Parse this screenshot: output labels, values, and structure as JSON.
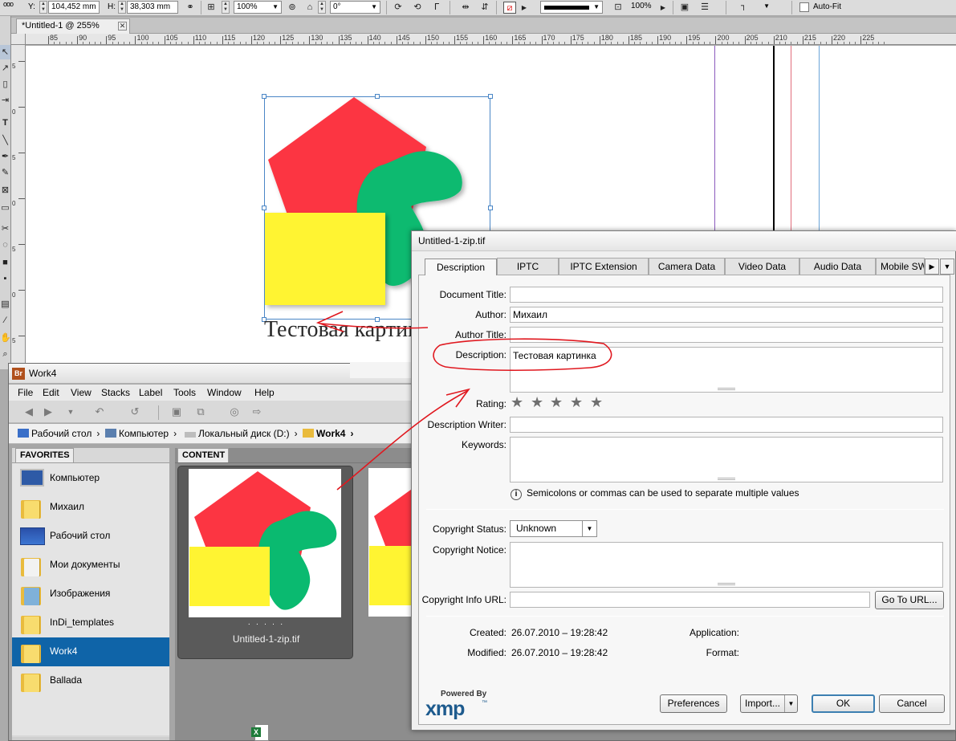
{
  "indesign": {
    "control_bar": {
      "y_label": "Y:",
      "y_value": "104,452 mm",
      "h_label": "H:",
      "h_value": "38,303 mm",
      "scale_value": "100%",
      "angle_value": "0°",
      "stroke_value": "100%",
      "autofit_label": "Auto-Fit"
    },
    "doc_tab_title": "*Untitled-1 @ 255%",
    "ruler_numbers": [
      "85",
      "90",
      "95",
      "100",
      "105",
      "110",
      "115",
      "120",
      "125",
      "130",
      "135",
      "140",
      "145",
      "150",
      "155",
      "160",
      "165",
      "170",
      "175",
      "180",
      "185",
      "190",
      "195",
      "200",
      "205",
      "210",
      "215",
      "220",
      "225"
    ],
    "vruler_numbers": [
      "5",
      "0",
      "5",
      "0",
      "5",
      "0",
      "5"
    ],
    "canvas_caption": "Тестовая картинка",
    "colors": {
      "pentagon": "#fc3542",
      "green_shape": "#0aba70",
      "yellow_rect": "#fff432",
      "selection": "#4a86c6",
      "annotation": "#e0181f"
    }
  },
  "bridge": {
    "title": "Work4",
    "app_icon": "Br",
    "menu": [
      "File",
      "Edit",
      "View",
      "Stacks",
      "Label",
      "Tools",
      "Window",
      "Help"
    ],
    "path": [
      "Рабочий стол",
      "Компьютер",
      "Локальный диск (D:)",
      "Work4"
    ],
    "favorites_tab": "FAVORITES",
    "favorites": [
      "Компьютер",
      "Михаил",
      "Рабочий стол",
      "Мои документы",
      "Изображения",
      "InDi_templates",
      "Work4",
      "Ballada"
    ],
    "selected_favorite": "Work4",
    "content_tab": "CONTENT",
    "thumbnail_name": "Untitled-1-zip.tif",
    "thumbnail_rating_dots": "· · · · ·"
  },
  "dialog": {
    "title": "Untitled-1-zip.tif",
    "tabs": [
      "Description",
      "IPTC",
      "IPTC Extension",
      "Camera Data",
      "Video Data",
      "Audio Data",
      "Mobile SWF"
    ],
    "active_tab": "Description",
    "labels": {
      "document_title": "Document Title:",
      "author": "Author:",
      "author_title": "Author Title:",
      "description": "Description:",
      "rating": "Rating:",
      "description_writer": "Description Writer:",
      "keywords": "Keywords:",
      "copyright_status": "Copyright Status:",
      "copyright_notice": "Copyright Notice:",
      "copyright_info_url": "Copyright Info URL:",
      "created": "Created:",
      "modified": "Modified:",
      "application": "Application:",
      "format": "Format:"
    },
    "values": {
      "document_title": "",
      "author": "Михаил",
      "author_title": "",
      "description": "Тестовая картинка",
      "rating": 0,
      "description_writer": "",
      "keywords": "",
      "copyright_status": "Unknown",
      "copyright_notice": "",
      "copyright_info_url": "",
      "created": "26.07.2010 – 19:28:42",
      "modified": "26.07.2010 – 19:28:42",
      "application": "",
      "format": ""
    },
    "keywords_hint": "Semicolons or commas can be used to separate multiple values",
    "goto_url_label": "Go To URL...",
    "buttons": {
      "preferences": "Preferences",
      "import": "Import...",
      "ok": "OK",
      "cancel": "Cancel"
    },
    "logo": {
      "powered_by": "Powered By",
      "name": "xmp",
      "tm": "™"
    }
  }
}
